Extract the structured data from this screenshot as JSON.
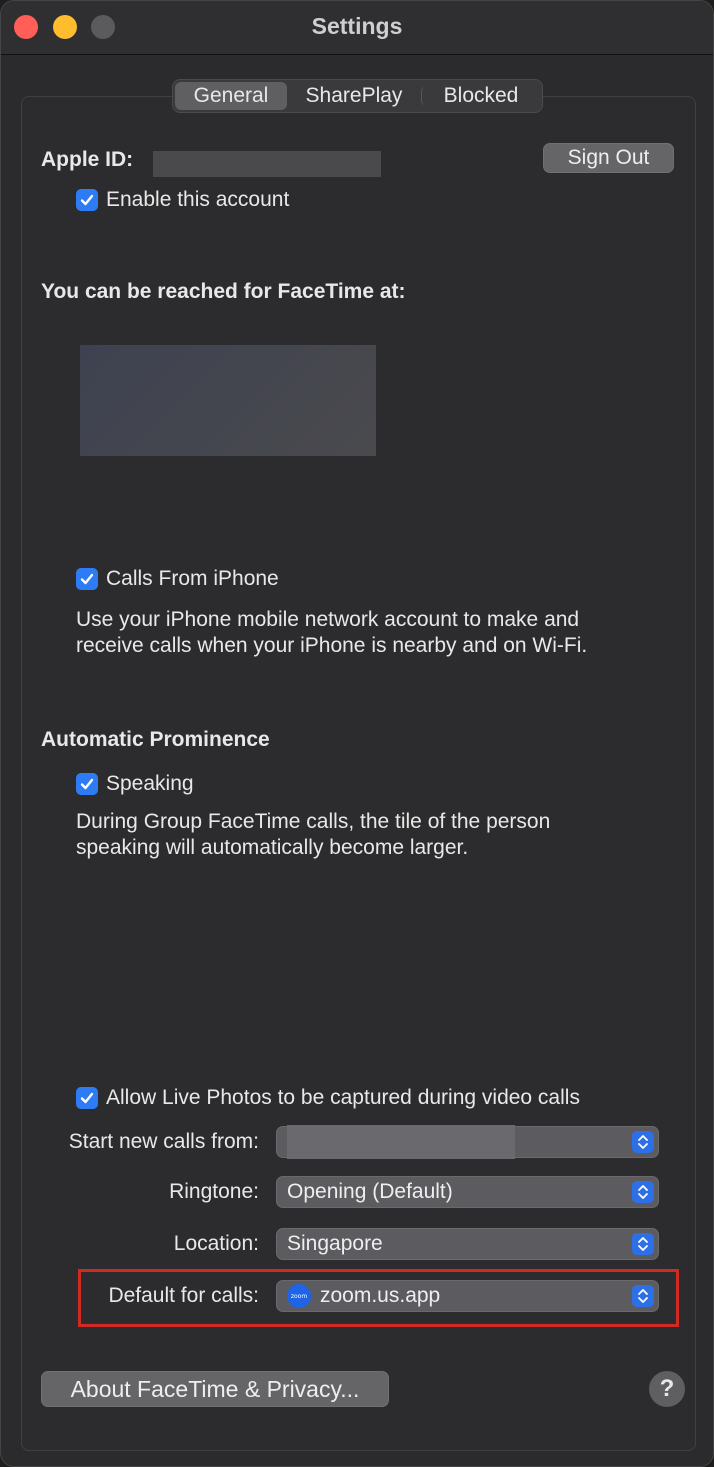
{
  "window": {
    "title": "Settings"
  },
  "tabs": [
    {
      "label": "General",
      "active": true
    },
    {
      "label": "SharePlay",
      "active": false
    },
    {
      "label": "Blocked",
      "active": false
    }
  ],
  "account": {
    "apple_id_label": "Apple ID:",
    "sign_out_label": "Sign Out",
    "enable_label": "Enable this account",
    "enable_checked": true
  },
  "reach": {
    "heading": "You can be reached for FaceTime at:"
  },
  "calls_from_iphone": {
    "label": "Calls From iPhone",
    "checked": true,
    "description": "Use your iPhone mobile network account to make and receive calls when your iPhone is nearby and on Wi-Fi."
  },
  "prominence": {
    "heading": "Automatic Prominence",
    "speaking_label": "Speaking",
    "speaking_checked": true,
    "description": "During Group FaceTime calls, the tile of the person speaking will automatically become larger."
  },
  "live_photos": {
    "label": "Allow Live Photos to be captured during video calls",
    "checked": true
  },
  "settings": {
    "start_calls_label": "Start new calls from:",
    "ringtone_label": "Ringtone:",
    "ringtone_value": "Opening (Default)",
    "location_label": "Location:",
    "location_value": "Singapore",
    "default_calls_label": "Default for calls:",
    "default_calls_value": "zoom.us.app",
    "zoom_icon_text": "zoom"
  },
  "footer": {
    "about_label": "About FaceTime & Privacy...",
    "help_label": "?"
  },
  "colors": {
    "accent": "#2d7cf6",
    "highlight": "#d02a22"
  }
}
